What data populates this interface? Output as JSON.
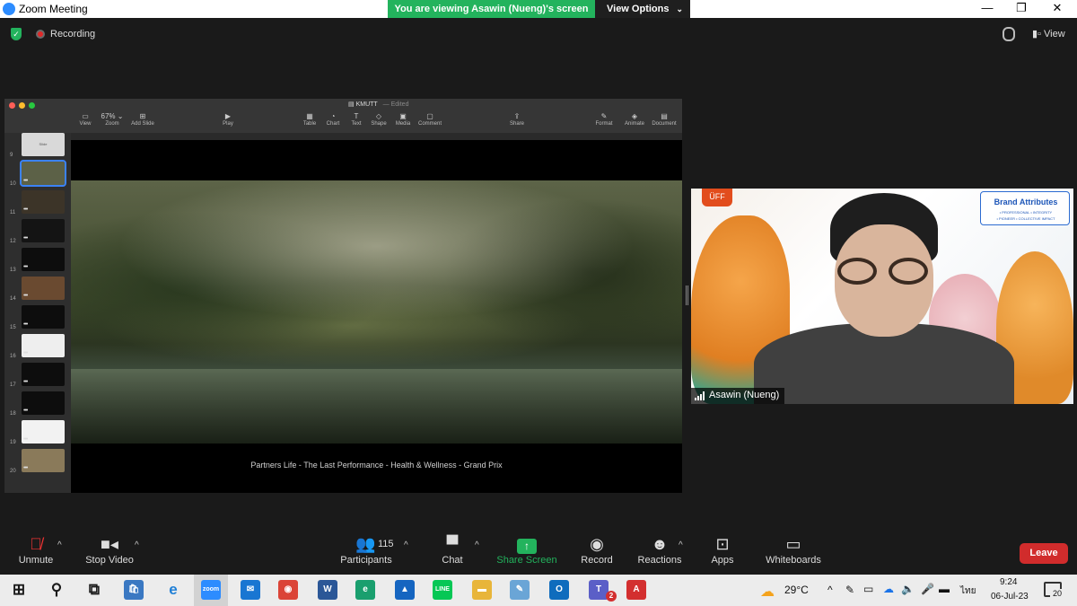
{
  "window": {
    "title": "Zoom Meeting",
    "minimize": "—",
    "restore": "❐",
    "close": "✕"
  },
  "share_banner": {
    "text": "You are viewing Asawin (Nueng)'s screen",
    "view_options": "View Options"
  },
  "topbar": {
    "recording_label": "Recording",
    "view_label": "View"
  },
  "shared_screen": {
    "doc_title": "KMUTT",
    "doc_status": "— Edited",
    "toolbar_left": [
      {
        "label": "View",
        "icon": "sidebar-icon",
        "glyph": "▭"
      },
      {
        "label": "Zoom",
        "icon": "zoom-icon",
        "glyph": "67% ⌄"
      },
      {
        "label": "Add Slide",
        "icon": "add-slide-icon",
        "glyph": "⊞"
      },
      {
        "label": "Play",
        "icon": "play-icon",
        "glyph": "▶"
      }
    ],
    "toolbar_middle": [
      {
        "label": "Table",
        "icon": "table-icon",
        "glyph": "▦"
      },
      {
        "label": "Chart",
        "icon": "chart-icon",
        "glyph": "◔"
      },
      {
        "label": "Text",
        "icon": "text-icon",
        "glyph": "T"
      },
      {
        "label": "Shape",
        "icon": "shape-icon",
        "glyph": "◇"
      },
      {
        "label": "Media",
        "icon": "media-icon",
        "glyph": "▣"
      },
      {
        "label": "Comment",
        "icon": "comment-icon",
        "glyph": "▢"
      },
      {
        "label": "Share",
        "icon": "share-icon",
        "glyph": "⇪"
      }
    ],
    "toolbar_right": [
      {
        "label": "Format",
        "icon": "format-icon",
        "glyph": "✎"
      },
      {
        "label": "Animate",
        "icon": "animate-icon",
        "glyph": "◈"
      },
      {
        "label": "Document",
        "icon": "document-icon",
        "glyph": "▤"
      }
    ],
    "slides": [
      {
        "num": "9",
        "thumb": "Slide",
        "dots": "",
        "color": "#d9d9d9"
      },
      {
        "num": "10",
        "thumb": "",
        "dots": "•••",
        "color": "#5c6147"
      },
      {
        "num": "11",
        "thumb": "",
        "dots": "•••",
        "color": "#3c3428"
      },
      {
        "num": "12",
        "thumb": "",
        "dots": "•••",
        "color": "#141414"
      },
      {
        "num": "13",
        "thumb": "",
        "dots": "•••",
        "color": "#0d0d0d"
      },
      {
        "num": "14",
        "thumb": "",
        "dots": "•••",
        "color": "#6a4a30"
      },
      {
        "num": "15",
        "thumb": "",
        "dots": "•••",
        "color": "#0d0d0d"
      },
      {
        "num": "16",
        "thumb": "",
        "dots": "•••",
        "color": "#eeeeee"
      },
      {
        "num": "17",
        "thumb": "",
        "dots": "•••",
        "color": "#0d0d0d"
      },
      {
        "num": "18",
        "thumb": "",
        "dots": "•••",
        "color": "#0d0d0d"
      },
      {
        "num": "19",
        "thumb": "",
        "dots": "•••",
        "color": "#f2f2f2"
      },
      {
        "num": "20",
        "thumb": "",
        "dots": "•••",
        "color": "#8a7a5a"
      }
    ],
    "caption": "Partners Life - The Last Performance - Health & Wellness - Grand Prix"
  },
  "participant": {
    "name": "Asawin (Nueng)",
    "logo_badge": "ÜFF",
    "brand_title": "Brand Attributes",
    "brand_sub_1": "• PROFESSIONAL • INTEGRITY",
    "brand_sub_2": "• PIONEER • COLLECTIVE IMPACT"
  },
  "toolbar": {
    "unmute": "Unmute",
    "stop_video": "Stop Video",
    "participants": "Participants",
    "participant_count": "115",
    "chat": "Chat",
    "share_screen": "Share Screen",
    "record": "Record",
    "reactions": "Reactions",
    "apps": "Apps",
    "whiteboards": "Whiteboards",
    "leave": "Leave"
  },
  "taskbar": {
    "apps": [
      {
        "name": "start",
        "icon": "windows-icon",
        "glyph": "⊞",
        "color": "#1a1a1a",
        "bg": "transparent"
      },
      {
        "name": "search",
        "icon": "search-icon",
        "glyph": "⚲",
        "color": "#1a1a1a",
        "bg": "transparent"
      },
      {
        "name": "task-view",
        "icon": "task-view-icon",
        "glyph": "⧉",
        "color": "#1a1a1a",
        "bg": "transparent"
      },
      {
        "name": "store",
        "icon": "store-icon",
        "glyph": "🛍",
        "color": "#fff",
        "bg": "#3a78c2"
      },
      {
        "name": "ie",
        "icon": "internet-explorer-icon",
        "glyph": "e",
        "color": "#1f7fd6",
        "bg": "transparent"
      },
      {
        "name": "zoom",
        "icon": "zoom-app-icon",
        "glyph": "zoom",
        "color": "#fff",
        "bg": "#2d8cff"
      },
      {
        "name": "mail",
        "icon": "mail-icon",
        "glyph": "✉",
        "color": "#fff",
        "bg": "#1976d2"
      },
      {
        "name": "chrome",
        "icon": "chrome-icon",
        "glyph": "◉",
        "color": "#fff",
        "bg": "#db4437"
      },
      {
        "name": "word",
        "icon": "word-icon",
        "glyph": "W",
        "color": "#fff",
        "bg": "#2b5797"
      },
      {
        "name": "edge",
        "icon": "edge-icon",
        "glyph": "e",
        "color": "#fff",
        "bg": "#1a9f6e"
      },
      {
        "name": "photos",
        "icon": "photos-icon",
        "glyph": "▲",
        "color": "#fff",
        "bg": "#1565c0"
      },
      {
        "name": "line",
        "icon": "line-icon",
        "glyph": "LINE",
        "color": "#fff",
        "bg": "#06c755"
      },
      {
        "name": "explorer",
        "icon": "file-explorer-icon",
        "glyph": "▬",
        "color": "#fff",
        "bg": "#e8b53a"
      },
      {
        "name": "notes",
        "icon": "notes-icon",
        "glyph": "✎",
        "color": "#fff",
        "bg": "#6aa5d6"
      },
      {
        "name": "outlook",
        "icon": "outlook-icon",
        "glyph": "O",
        "color": "#fff",
        "bg": "#0f6cbd"
      },
      {
        "name": "teams",
        "icon": "teams-icon",
        "glyph": "T",
        "color": "#fff",
        "bg": "#5b5fc7"
      },
      {
        "name": "acrobat",
        "icon": "acrobat-icon",
        "glyph": "A",
        "color": "#fff",
        "bg": "#d32f2f"
      }
    ],
    "teams_badge": "2",
    "weather": "29°C",
    "language": "ไทย",
    "time": "9:24",
    "date": "06-Jul-23",
    "notification_count": "20"
  }
}
